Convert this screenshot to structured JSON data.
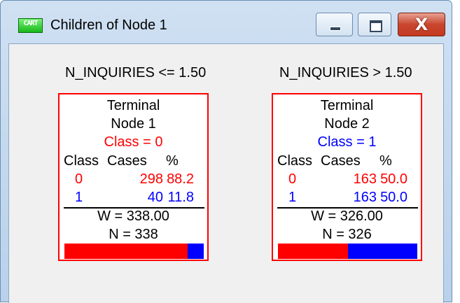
{
  "window": {
    "title": "Children of Node 1",
    "app_icon_text": "CART",
    "controls": {
      "minimize": "minimize-icon",
      "maximize": "maximize-icon",
      "close": "close-icon",
      "close_glyph": "X"
    }
  },
  "colors": {
    "class0": "#ff0000",
    "class1": "#0000ff",
    "node_border": "#ff0000"
  },
  "children": [
    {
      "condition": "N_INQUIRIES <= 1.50",
      "type": "Terminal",
      "node": "Node 1",
      "class_label": "Class = 0",
      "header": {
        "class": "Class",
        "cases": "Cases",
        "pct": "%"
      },
      "rows": [
        {
          "class": "0",
          "cases": "298",
          "pct": "88.2"
        },
        {
          "class": "1",
          "cases": "40",
          "pct": "11.8"
        }
      ],
      "weight": "W = 338.00",
      "n": "N = 338",
      "bar_class0_fraction": 0.882,
      "bar_class1_fraction": 0.118
    },
    {
      "condition": "N_INQUIRIES > 1.50",
      "type": "Terminal",
      "node": "Node 2",
      "class_label": "Class = 1",
      "header": {
        "class": "Class",
        "cases": "Cases",
        "pct": "%"
      },
      "rows": [
        {
          "class": "0",
          "cases": "163",
          "pct": "50.0"
        },
        {
          "class": "1",
          "cases": "163",
          "pct": "50.0"
        }
      ],
      "weight": "W = 326.00",
      "n": "N = 326",
      "bar_class0_fraction": 0.5,
      "bar_class1_fraction": 0.5
    }
  ]
}
